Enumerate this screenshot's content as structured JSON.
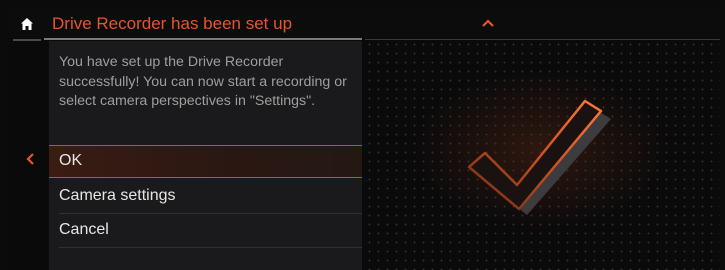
{
  "header": {
    "title": "Drive Recorder has been set up",
    "home_icon": "home-icon",
    "collapse_icon": "chevron-up-icon"
  },
  "nav": {
    "back_icon": "chevron-left-icon"
  },
  "dialog": {
    "message": "You have set up the Drive Recorder successfully! You can now start a recording or select camera perspectives in \"Settings\".",
    "options": [
      {
        "label": "OK",
        "selected": true
      },
      {
        "label": "Camera settings",
        "selected": false
      },
      {
        "label": "Cancel",
        "selected": false
      }
    ]
  },
  "illustration": {
    "icon": "checkmark-icon"
  },
  "colors": {
    "accent": "#e8542a",
    "background": "#0a0a0b",
    "panel": "#1a1a1c",
    "text": "#e6e6e6",
    "muted_text": "#9e9e9e"
  }
}
